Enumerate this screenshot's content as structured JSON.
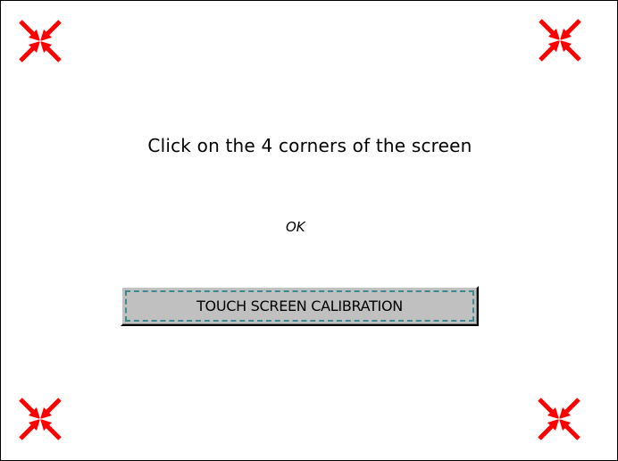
{
  "screen": {
    "instruction": "Click on the 4 corners of the screen",
    "status_text": "OK"
  },
  "calibration_button": {
    "label": "TOUCH SCREEN CALIBRATION",
    "focus_outline_color": "#3a8a8f"
  },
  "targets": [
    {
      "corner": "top-left",
      "icon": "calibration-target-icon"
    },
    {
      "corner": "top-right",
      "icon": "calibration-target-icon"
    },
    {
      "corner": "bottom-left",
      "icon": "calibration-target-icon"
    },
    {
      "corner": "bottom-right",
      "icon": "calibration-target-icon"
    }
  ],
  "colors": {
    "target": "#ff0000",
    "button_face": "#c0c0c0",
    "background": "#ffffff"
  }
}
